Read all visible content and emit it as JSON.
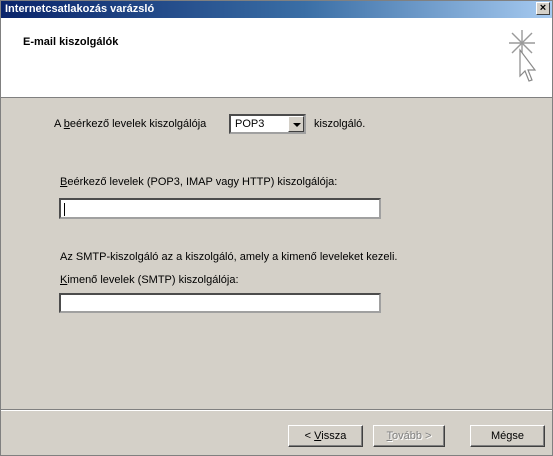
{
  "window": {
    "title": "Internetcsatlakozás varázsló",
    "close_glyph": "×"
  },
  "header": {
    "title": "E-mail kiszolgálók",
    "icon": "wizard-sparkle-cursor-icon"
  },
  "incoming": {
    "prefix_a": "A ",
    "prefix_hot": "b",
    "prefix_rest": "eérkező levelek kiszolgálója",
    "server_type": "POP3",
    "suffix": "kiszolgáló."
  },
  "incoming_server": {
    "label_hot": "B",
    "label_rest": "eérkező levelek (POP3, IMAP vagy HTTP) kiszolgálója:",
    "value": ""
  },
  "smtp": {
    "info": "Az SMTP-kiszolgáló az a kiszolgáló, amely a kimenő leveleket kezeli.",
    "label_hot": "K",
    "label_rest": "imenő levelek (SMTP) kiszolgálója:",
    "value": ""
  },
  "buttons": {
    "back_prefix": "< ",
    "back_hot": "V",
    "back_rest": "issza",
    "next_hot": "T",
    "next_rest": "ovább >",
    "cancel": "Mégse"
  }
}
